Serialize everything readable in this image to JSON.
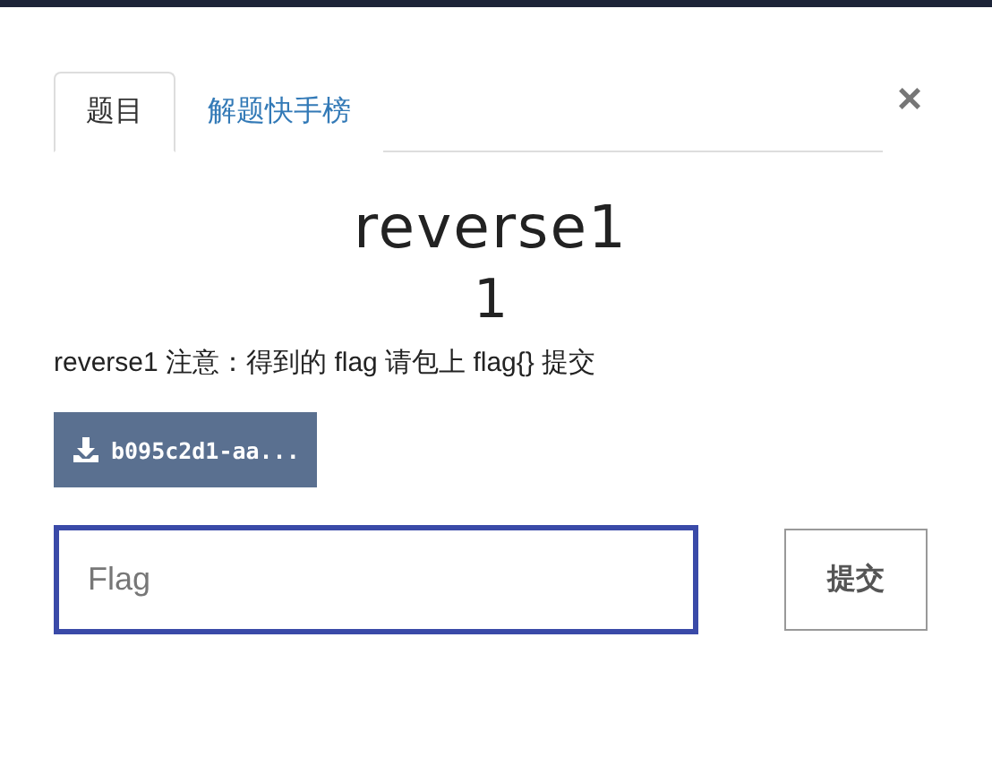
{
  "tabs": [
    {
      "label": "题目",
      "selected": true
    },
    {
      "label": "解题快手榜",
      "selected": false
    }
  ],
  "close": "×",
  "challenge": {
    "title": "reverse1",
    "points": "1",
    "description": "reverse1 注意：得到的 flag 请包上 flag{} 提交"
  },
  "download": {
    "label": "b095c2d1-aa..."
  },
  "flag_input": {
    "placeholder": "Flag",
    "focused": true
  },
  "submit": "提交"
}
